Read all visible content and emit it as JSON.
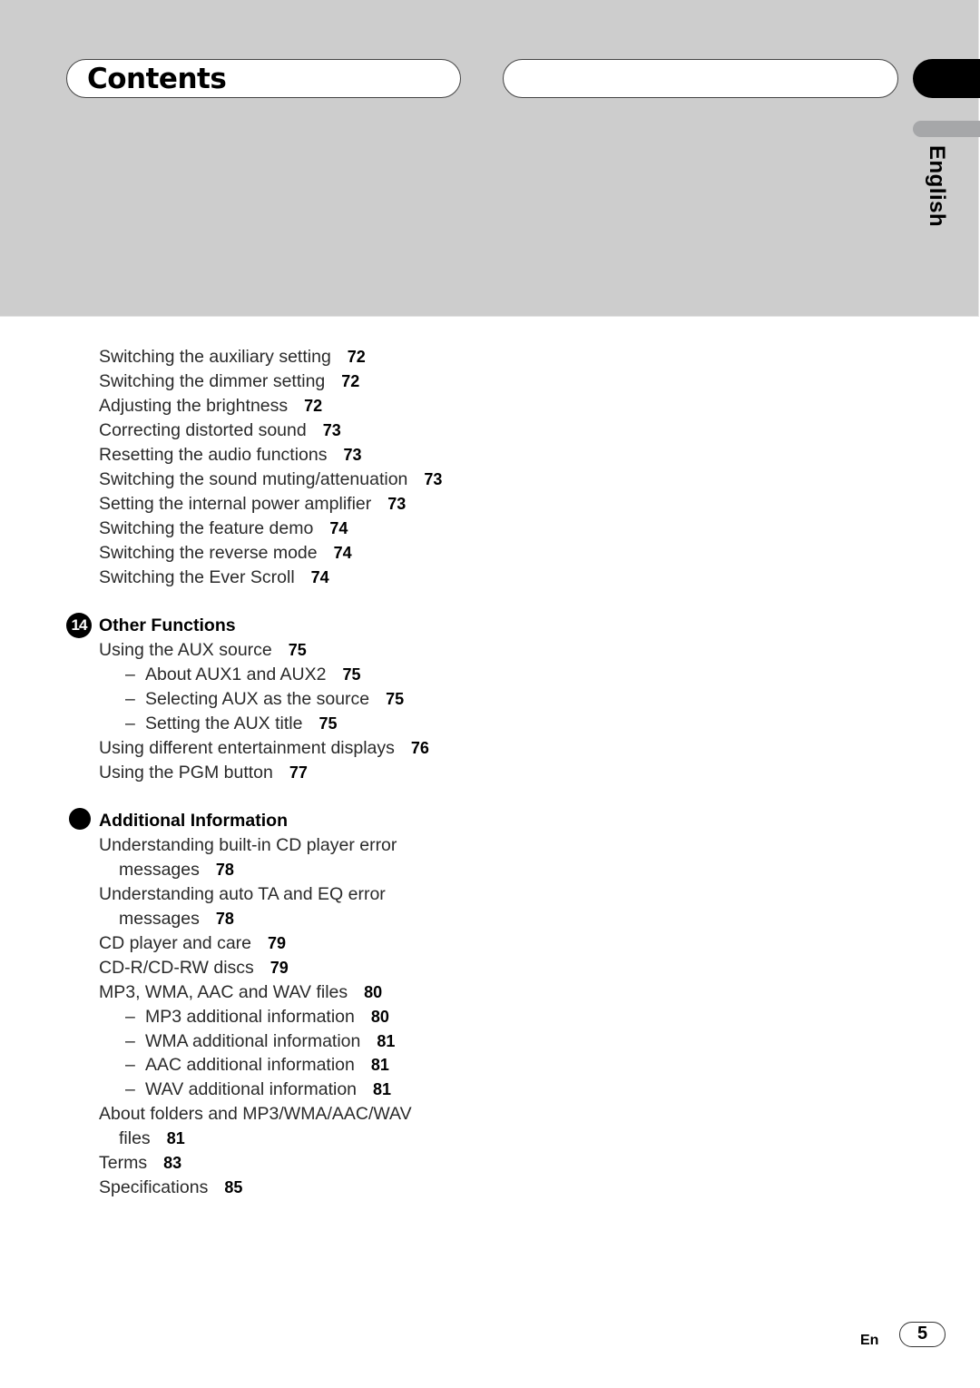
{
  "header": {
    "title": "Contents",
    "language_tab": "English"
  },
  "toc": {
    "continued_entries": [
      {
        "text": "Switching the auxiliary setting",
        "page": "72"
      },
      {
        "text": "Switching the dimmer setting",
        "page": "72"
      },
      {
        "text": "Adjusting the brightness",
        "page": "72"
      },
      {
        "text": "Correcting distorted sound",
        "page": "73"
      },
      {
        "text": "Resetting the audio functions",
        "page": "73"
      },
      {
        "text": "Switching the sound muting/attenuation",
        "page": "73"
      },
      {
        "text": "Setting the internal power amplifier",
        "page": "73"
      },
      {
        "text": "Switching the feature demo",
        "page": "74"
      },
      {
        "text": "Switching the reverse mode",
        "page": "74"
      },
      {
        "text": "Switching the Ever Scroll",
        "page": "74"
      }
    ],
    "sections": [
      {
        "number": "14",
        "title": "Other Functions",
        "entries": [
          {
            "text": "Using the AUX source",
            "page": "75"
          },
          {
            "dash": "–",
            "text": "About AUX1 and AUX2",
            "page": "75"
          },
          {
            "dash": "–",
            "text": "Selecting AUX as the source",
            "page": "75"
          },
          {
            "dash": "–",
            "text": "Setting the AUX title",
            "page": "75"
          },
          {
            "text": "Using different entertainment displays",
            "page": "76"
          },
          {
            "text": "Using the PGM button",
            "page": "77"
          }
        ]
      },
      {
        "number": "",
        "title": "Additional Information",
        "entries": [
          {
            "text": "Understanding built-in CD player error",
            "page": ""
          },
          {
            "text": "messages",
            "page": "78"
          },
          {
            "text": "Understanding auto TA and EQ error",
            "page": ""
          },
          {
            "text": "messages",
            "page": "78"
          },
          {
            "text": "CD player and care",
            "page": "79"
          },
          {
            "text": "CD-R/CD-RW discs",
            "page": "79"
          },
          {
            "text": "MP3, WMA, AAC and WAV files",
            "page": "80"
          },
          {
            "dash": "–",
            "text": "MP3 additional information",
            "page": "80"
          },
          {
            "dash": "–",
            "text": "WMA additional information",
            "page": "81"
          },
          {
            "dash": "–",
            "text": "AAC additional information",
            "page": "81"
          },
          {
            "dash": "–",
            "text": "WAV additional information",
            "page": "81"
          },
          {
            "text": "About folders and MP3/WMA/AAC/WAV",
            "page": ""
          },
          {
            "text": "files",
            "page": "81"
          },
          {
            "text": "Terms",
            "page": "83"
          },
          {
            "text": "Specifications",
            "page": "85"
          }
        ]
      }
    ]
  },
  "footer": {
    "language": "En",
    "page_number": "5"
  }
}
